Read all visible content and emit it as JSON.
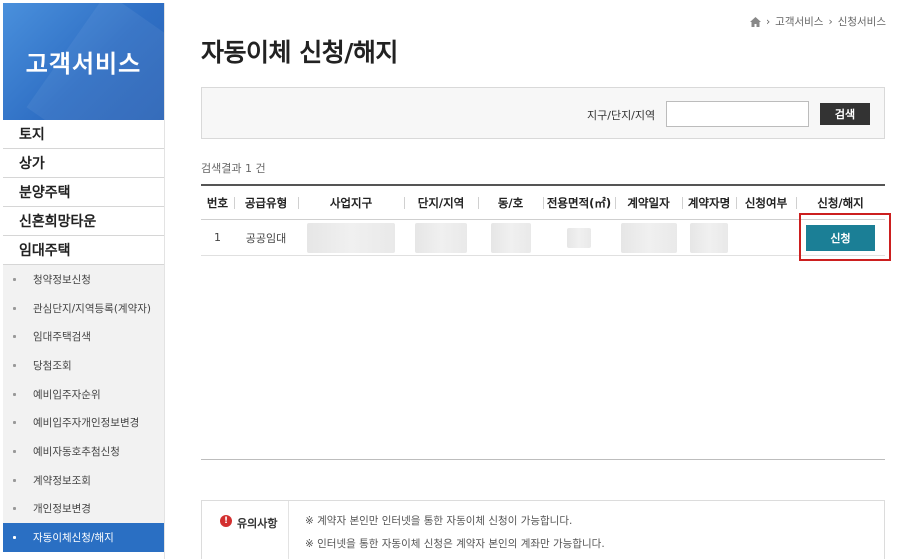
{
  "sidebar": {
    "title": "고객서비스",
    "main_items": [
      "토지",
      "상가",
      "분양주택",
      "신혼희망타운",
      "임대주택"
    ],
    "sub_items": [
      {
        "label": "청약정보신청",
        "active": false
      },
      {
        "label": "관심단지/지역등록(계약자)",
        "active": false
      },
      {
        "label": "임대주택검색",
        "active": false
      },
      {
        "label": "당첨조회",
        "active": false
      },
      {
        "label": "예비입주자순위",
        "active": false
      },
      {
        "label": "예비입주자개인정보변경",
        "active": false
      },
      {
        "label": "예비자동호추첨신청",
        "active": false
      },
      {
        "label": "계약정보조회",
        "active": false
      },
      {
        "label": "개인정보변경",
        "active": false
      },
      {
        "label": "자동이체신청/해지",
        "active": true
      }
    ]
  },
  "breadcrumb": {
    "home_icon": "home-icon",
    "items": [
      "고객서비스",
      "신청서비스"
    ]
  },
  "page_title": "자동이체 신청/해지",
  "search": {
    "label": "지구/단지/지역",
    "input_value": "",
    "button_label": "검색"
  },
  "result_count": "검색결과 1 건",
  "table": {
    "headers": [
      "번호",
      "공급유형",
      "사업지구",
      "단지/지역",
      "동/호",
      "전용면적(㎡)",
      "계약일자",
      "계약자명",
      "신청여부",
      "신청/해지"
    ],
    "rows": [
      {
        "no": "1",
        "type": "공공임대",
        "district": "",
        "complex": "",
        "unit": "",
        "area": "",
        "contract_date": "",
        "contractor": "",
        "status": "",
        "action": "신청"
      }
    ]
  },
  "notice": {
    "title": "유의사항",
    "lines": [
      "※ 계약자 본인만 인터넷을 통한 자동이체 신청이 가능합니다.",
      "※ 인터넷을 통한 자동이체 신청은 계약자 본인의 계좌만 가능합니다."
    ]
  },
  "colors": {
    "sidebar_header": "#2f6fc4",
    "active_item": "#2a6fc3",
    "apply_button": "#1b7f96",
    "highlight": "#cc1f1f"
  }
}
